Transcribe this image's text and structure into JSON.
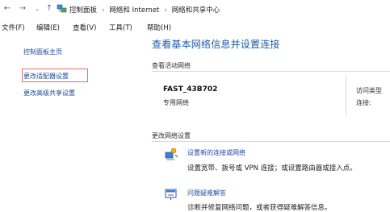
{
  "address_bar": {
    "crumbs": [
      "控制面板",
      "网络和 Internet",
      "网络和共享中心"
    ]
  },
  "menu": [
    "文件(F)",
    "编辑(E)",
    "查看(V)",
    "工具(T)",
    "帮助(H)"
  ],
  "left_pane": {
    "home": "控制面板主页",
    "adapter": "更改适配器设置",
    "advanced": "更改高级共享设置"
  },
  "main": {
    "title": "查看基本网络信息并设置连接",
    "active_label": "查看活动网络",
    "network_name": "FAST_43B702",
    "network_type": "专用网络",
    "access_type_label": "访问类型",
    "connection_label": "连接:",
    "change_label": "更改网络设置",
    "tasks": [
      {
        "link": "设置新的连接或网络",
        "desc": "设置宽带、拨号或 VPN 连接；或设置路由器或接入点。"
      },
      {
        "link": "问题疑难解答",
        "desc": "诊断并修复网络问题，或者获得疑难解答信息。"
      }
    ]
  },
  "colors": {
    "link": "#1f4a9e",
    "title": "#1e5aa8",
    "focus": "#e07070"
  },
  "icons": [
    "back-arrow-icon",
    "forward-arrow-icon",
    "dropdown-chevron-icon",
    "up-arrow-icon",
    "network-center-icon",
    "new-connection-icon",
    "troubleshoot-icon"
  ]
}
